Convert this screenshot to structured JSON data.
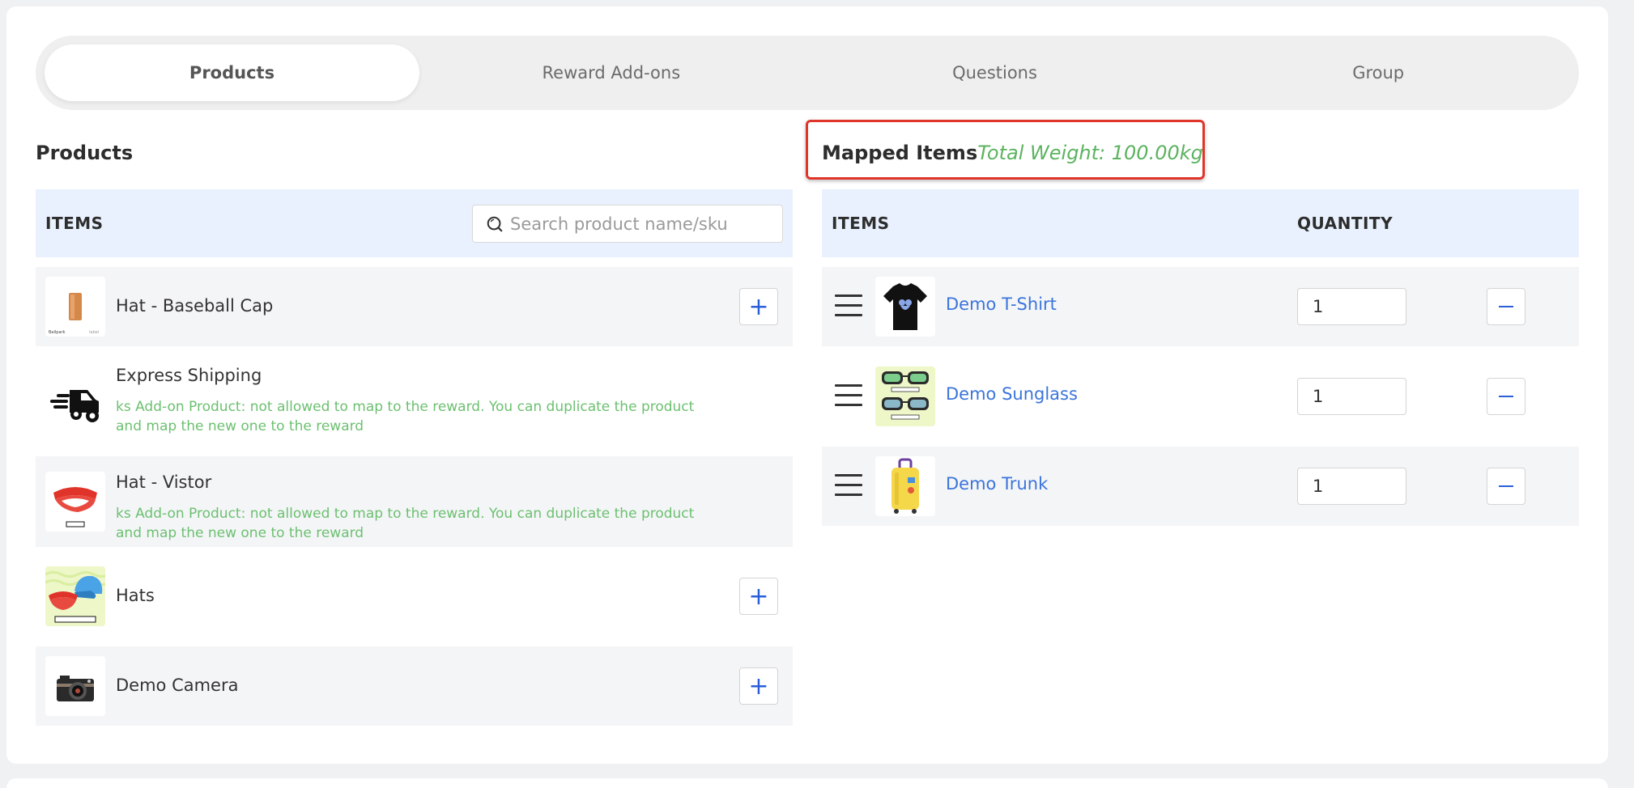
{
  "tabs": [
    {
      "label": "Products",
      "active": true
    },
    {
      "label": "Reward Add-ons",
      "active": false
    },
    {
      "label": "Questions",
      "active": false
    },
    {
      "label": "Group",
      "active": false
    }
  ],
  "products": {
    "title": "Products",
    "items_header": "ITEMS",
    "search_placeholder": "Search product name/sku",
    "rows": [
      {
        "name": "Hat - Baseball Cap",
        "icon": "baseball-cap-thumbnail",
        "addable": true
      },
      {
        "name": "Express Shipping",
        "icon": "delivery-truck-icon",
        "warning": "ks Add-on Product: not allowed to map to the reward. You can duplicate the product and map the new one to the reward"
      },
      {
        "name": "Hat - Vistor",
        "icon": "visor-thumbnail",
        "warning": "ks Add-on Product: not allowed to map to the reward. You can duplicate the product and map the new one to the reward"
      },
      {
        "name": "Hats",
        "icon": "hats-thumbnail",
        "addable": true
      },
      {
        "name": "Demo Camera",
        "icon": "camera-thumbnail",
        "addable": true
      }
    ],
    "add_symbol": "+"
  },
  "mapped": {
    "title": "Mapped Items",
    "total_weight": "Total Weight: 100.00kg",
    "items_header": "ITEMS",
    "quantity_header": "QUANTITY",
    "rows": [
      {
        "name": "Demo T-Shirt",
        "qty": "1",
        "icon": "tshirt-thumbnail"
      },
      {
        "name": "Demo Sunglass",
        "qty": "1",
        "icon": "sunglass-thumbnail"
      },
      {
        "name": "Demo Trunk",
        "qty": "1",
        "icon": "trunk-thumbnail"
      }
    ]
  },
  "colors": {
    "accent": "#2b5fd9",
    "link": "#3b74db",
    "warning_text": "#6cc070",
    "weight_text": "#5bb35f",
    "highlight": "#e0352b",
    "header_bg": "#e8f1fd"
  }
}
